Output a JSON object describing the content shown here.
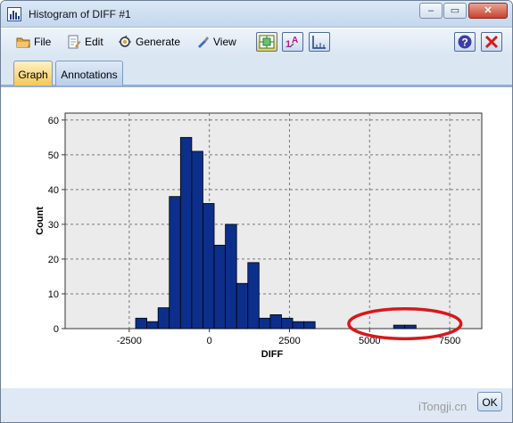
{
  "window": {
    "title": "Histogram of DIFF #1",
    "buttons": {
      "minimize": "–",
      "maximize": "▭",
      "close": "✕"
    }
  },
  "menu": {
    "file": "File",
    "edit": "Edit",
    "generate": "Generate",
    "view": "View"
  },
  "toolbar": {
    "help_icon": "?",
    "close_icon": "✕"
  },
  "tabs": [
    {
      "label": "Graph",
      "active": true
    },
    {
      "label": "Annotations",
      "active": false
    }
  ],
  "footer": {
    "ok_label": "OK",
    "watermark": "iTongji.cn"
  },
  "chart_data": {
    "type": "bar",
    "title": "",
    "xlabel": "DIFF",
    "ylabel": "Count",
    "xlim": [
      -4500,
      8500
    ],
    "ylim": [
      0,
      62
    ],
    "xticks": [
      -2500,
      0,
      2500,
      5000,
      7500
    ],
    "xtick_labels": [
      "-2500",
      "0",
      "2500",
      "5000",
      "7500"
    ],
    "yticks": [
      0,
      10,
      20,
      30,
      40,
      50,
      60
    ],
    "ytick_labels": [
      "0",
      "10",
      "20",
      "30",
      "40",
      "50",
      "60"
    ],
    "grid": true,
    "bar_color": "#0c2f8c",
    "highlight_color": "#d8171b",
    "bins": [
      {
        "x0": -2300,
        "x1": -1950,
        "count": 3
      },
      {
        "x0": -1950,
        "x1": -1600,
        "count": 2
      },
      {
        "x0": -1600,
        "x1": -1250,
        "count": 6
      },
      {
        "x0": -1250,
        "x1": -900,
        "count": 38
      },
      {
        "x0": -900,
        "x1": -550,
        "count": 55
      },
      {
        "x0": -550,
        "x1": -200,
        "count": 51
      },
      {
        "x0": -200,
        "x1": 150,
        "count": 36
      },
      {
        "x0": 150,
        "x1": 500,
        "count": 24
      },
      {
        "x0": 500,
        "x1": 850,
        "count": 30
      },
      {
        "x0": 850,
        "x1": 1200,
        "count": 13
      },
      {
        "x0": 1200,
        "x1": 1550,
        "count": 19
      },
      {
        "x0": 1550,
        "x1": 1900,
        "count": 3
      },
      {
        "x0": 1900,
        "x1": 2250,
        "count": 4
      },
      {
        "x0": 2250,
        "x1": 2600,
        "count": 3
      },
      {
        "x0": 2600,
        "x1": 2950,
        "count": 2
      },
      {
        "x0": 2950,
        "x1": 3300,
        "count": 2
      },
      {
        "x0": 5750,
        "x1": 6100,
        "count": 1
      },
      {
        "x0": 6100,
        "x1": 6450,
        "count": 1
      }
    ],
    "highlight": {
      "x_center": 6100,
      "y_center": 1.4,
      "x_radius": 1750,
      "y_radius": 4.3
    }
  }
}
